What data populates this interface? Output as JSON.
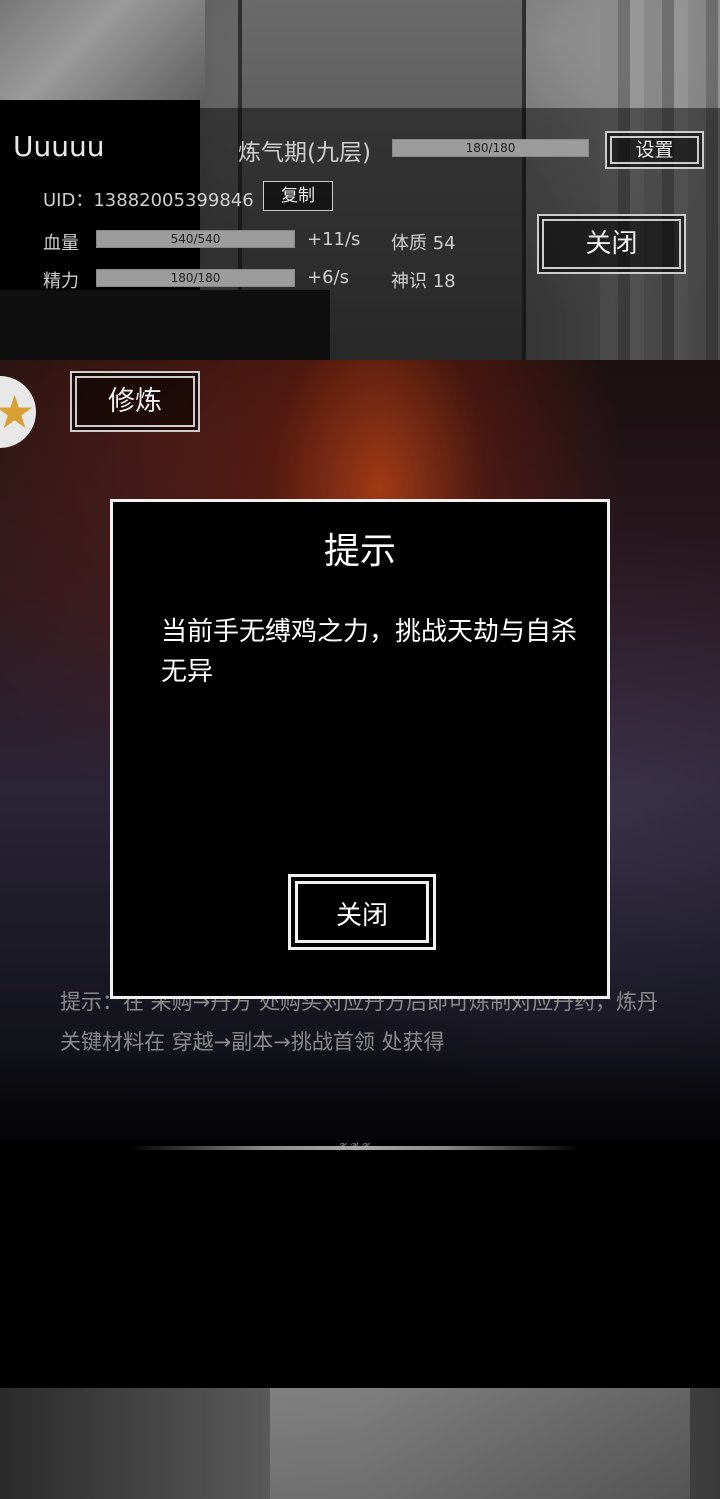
{
  "player": {
    "name": "Uuuuu",
    "realm": "炼气期(九层)",
    "realm_exp_text": "180/180",
    "realm_exp_fraction": 1.0,
    "uid_text": "UID：13882005399846"
  },
  "buttons": {
    "settings": "设置",
    "copy": "复制",
    "close_panel": "关闭",
    "cultivate": "修炼"
  },
  "stats": {
    "hp": {
      "label": "血量",
      "text": "540/540",
      "fraction": 1.0,
      "rate": "+11/s"
    },
    "energy": {
      "label": "精力",
      "text": "180/180",
      "fraction": 1.0,
      "rate": "+6/s"
    },
    "constitution": "体质 54",
    "spirit": "神识 18"
  },
  "hint": "提示：在 采购→丹方 处购买对应丹方后即可炼制对应丹药，炼丹关键材料在 穿越→副本→挑战首领 处获得",
  "dialog": {
    "title": "提示",
    "message": "当前手无缚鸡之力，挑战天劫与自杀无异",
    "close": "关闭"
  },
  "icons": {
    "avatar": "star-badge-icon"
  }
}
